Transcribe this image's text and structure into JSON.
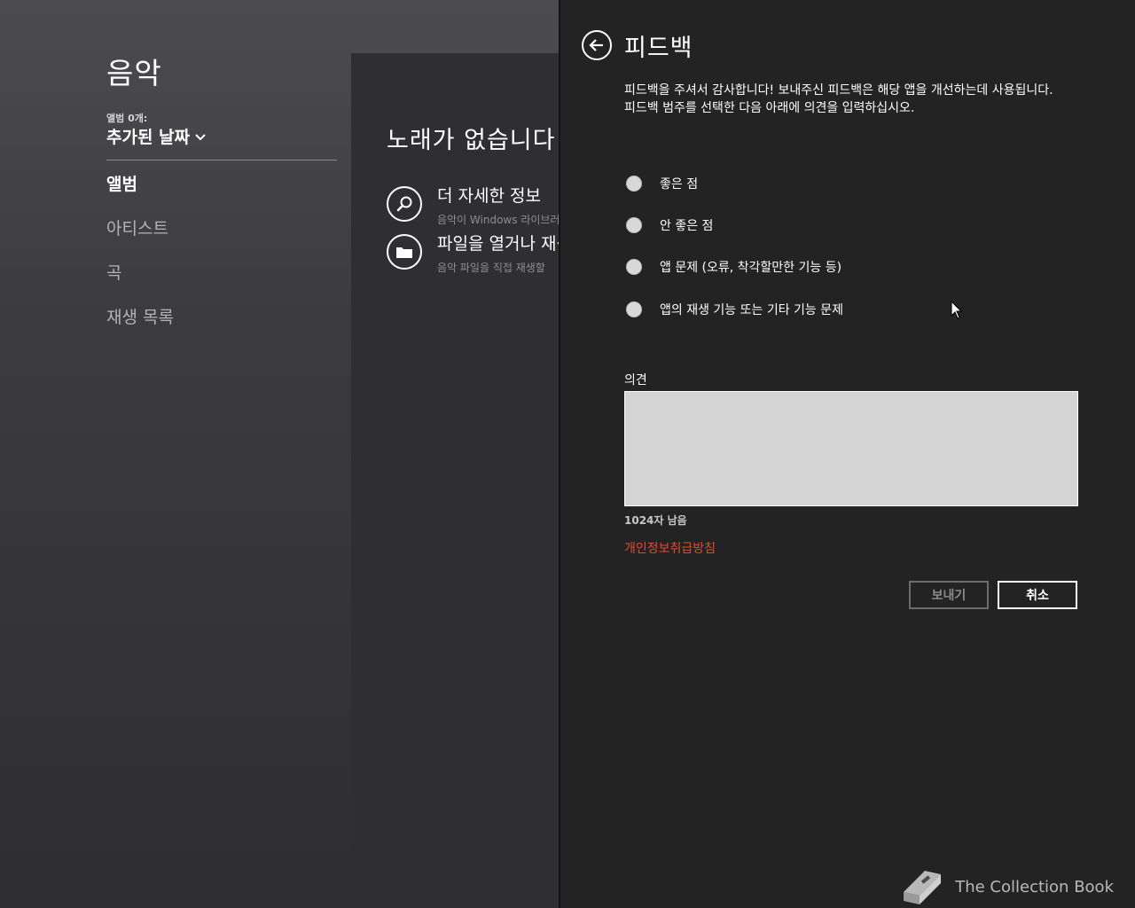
{
  "app": {
    "title": "음악",
    "album_count": "앨범 0개:",
    "sort_label": "추가된 날짜"
  },
  "nav": {
    "items": [
      {
        "label": "앨범",
        "active": true
      },
      {
        "label": "아티스트",
        "active": false
      },
      {
        "label": "곡",
        "active": false
      },
      {
        "label": "재생 목록",
        "active": false
      }
    ]
  },
  "content": {
    "empty_title": "노래가 없습니다",
    "actions": [
      {
        "title": "더 자세한 정보",
        "subtitle": "음악이 Windows 라이브러리",
        "icon": "search-icon"
      },
      {
        "title": "파일을 열거나 재생",
        "subtitle": "음악 파일을 직접 재생할",
        "icon": "folder-icon"
      }
    ]
  },
  "feedback": {
    "title": "피드백",
    "intro_line1": "피드백을 주셔서 감사합니다! 보내주신 피드백은 해당 앱을 개선하는데 사용됩니다.",
    "intro_line2": "피드백 범주를 선택한 다음 아래에 의견을 입력하십시오.",
    "options": [
      "좋은 점",
      "안 좋은 점",
      "앱 문제 (오류, 착각할만한 기능 등)",
      "앱의 재생 기능 또는 기타 기능 문제"
    ],
    "opinion_label": "의견",
    "opinion_value": "",
    "chars_left": "1024자 남음",
    "privacy_link": "개인정보취급방침",
    "send_label": "보내기",
    "cancel_label": "취소"
  },
  "watermark": {
    "text": "The Collection Book"
  },
  "colors": {
    "flyout_bg": "#232323",
    "privacy_link": "#e04b2f",
    "radio_fill": "#d8d8d8",
    "textbox_bg": "#d4d4d4"
  }
}
